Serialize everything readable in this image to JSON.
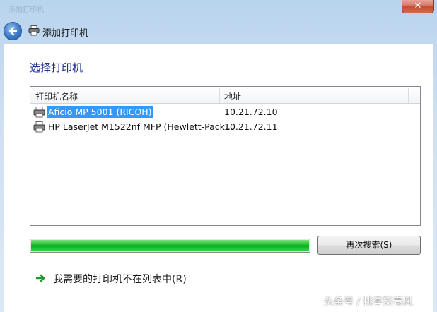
{
  "window": {
    "title": "添加打印机",
    "close_label": "✕"
  },
  "nav": {
    "title": "添加打印机",
    "back_icon": "back-arrow-icon",
    "printer_icon": "printer-icon"
  },
  "main": {
    "heading": "选择打印机",
    "columns": {
      "name": "打印机名称",
      "address": "地址"
    },
    "printers": [
      {
        "name": "Aficio MP 5001 (RICOH)",
        "address": "10.21.72.10",
        "selected": true
      },
      {
        "name": "HP LaserJet M1522nf MFP (Hewlett-Pack...",
        "address": "10.21.72.11",
        "selected": false
      }
    ],
    "progress_fraction": 1.0,
    "search_button": "再次搜索(S)",
    "not_listed_link": "我需要的打印机不在列表中(R)"
  },
  "watermark": "头条号 / 桃李笑春风",
  "colors": {
    "heading": "#1e3287",
    "selection": "#3399ff",
    "progress": "#06b025",
    "link_arrow": "#1f9a2e"
  }
}
